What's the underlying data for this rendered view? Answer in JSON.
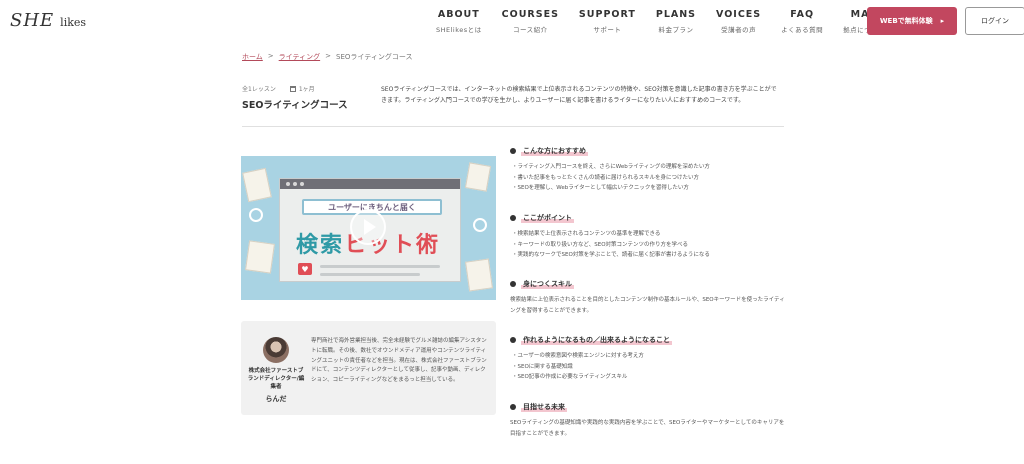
{
  "header": {
    "logo": {
      "she": "SHE",
      "likes": "likes"
    },
    "nav": [
      {
        "en": "ABOUT",
        "ja": "SHElikesとは"
      },
      {
        "en": "COURSES",
        "ja": "コース紹介"
      },
      {
        "en": "SUPPORT",
        "ja": "サポート"
      },
      {
        "en": "PLANS",
        "ja": "料金プラン"
      },
      {
        "en": "VOICES",
        "ja": "受講者の声"
      },
      {
        "en": "FAQ",
        "ja": "よくある質問"
      },
      {
        "en": "MAP",
        "ja": "拠点について"
      }
    ],
    "trial_button": "WEBで無料体験",
    "trial_arrow": "▸",
    "login_button": "ログイン"
  },
  "breadcrumb": {
    "home": "ホーム",
    "sep": ">",
    "writing": "ライティング",
    "current": "SEOライティングコース"
  },
  "course": {
    "lessons": "全1レッスン",
    "duration": "1ヶ月",
    "title": "SEOライティングコース",
    "description": "SEOライティングコースでは、インターネットの検索結果で上位表示されるコンテンツの特徴や、SEO対策を意識した記事の書き方を学ぶことができます。ライティング入門コースでの学びを生かし、よりユーザーに届く記事を書けるライターになりたい人におすすめのコースです。"
  },
  "video": {
    "search_text": "ユーザーにきちんと届く",
    "big_text_1": "検索",
    "big_text_2": "ヒット術",
    "heart": "♥"
  },
  "instructor": {
    "company": "株式会社ファーストブランドディレクター/編集者",
    "name": "らんだ",
    "bio": "専門商社で海外営業担当後、完全未経験でグルメ雑誌の編集アシスタントに転職。その後、数社でオウンドメディア運用やコンテンツライティングユニットの責任者などを担当。現在は、株式会社ファーストブランドにて、コンテンツディレクターとして従事し、記事や動画、ディレクション、コピーライティングなどをまるっと担当している。"
  },
  "sections": {
    "recommended": {
      "title": "こんな方におすすめ",
      "items": [
        "・ライティング入門コースを終え、さらにWebライティングの理解を深めたい方",
        "・書いた記事をもっとたくさんの読者に届けられるスキルを身につけたい方",
        "・SEOを理解し、Webライターとして幅広いテクニックを習得したい方"
      ]
    },
    "points": {
      "title": "ここがポイント",
      "items": [
        "・検索結果で上位表示されるコンテンツの基準を理解できる",
        "・キーワードの取り扱い方など、SEO対策コンテンツの作り方を学べる",
        "・実践的なワークでSEO対策を学ぶことで、読者に届く記事が書けるようになる"
      ]
    },
    "skills": {
      "title": "身につくスキル",
      "text": "検索結果に上位表示されることを目的としたコンテンツ制作の基本ルールや、SEOキーワードを使ったライティングを習得することができます。"
    },
    "outcomes": {
      "title": "作れるようになるもの／出来るようになること",
      "items": [
        "・ユーザーの検索意図や検索エンジンに対する考え方",
        "・SEOに関する基礎知識",
        "・SEO記事の作成に必要なライティングスキル"
      ]
    },
    "future": {
      "title": "目指せる未来",
      "text": "SEOライティングの基礎知識や実践的な実践内容を学ぶことで、SEOライターやマーケターとしてのキャリアを目指すことができます。"
    }
  }
}
